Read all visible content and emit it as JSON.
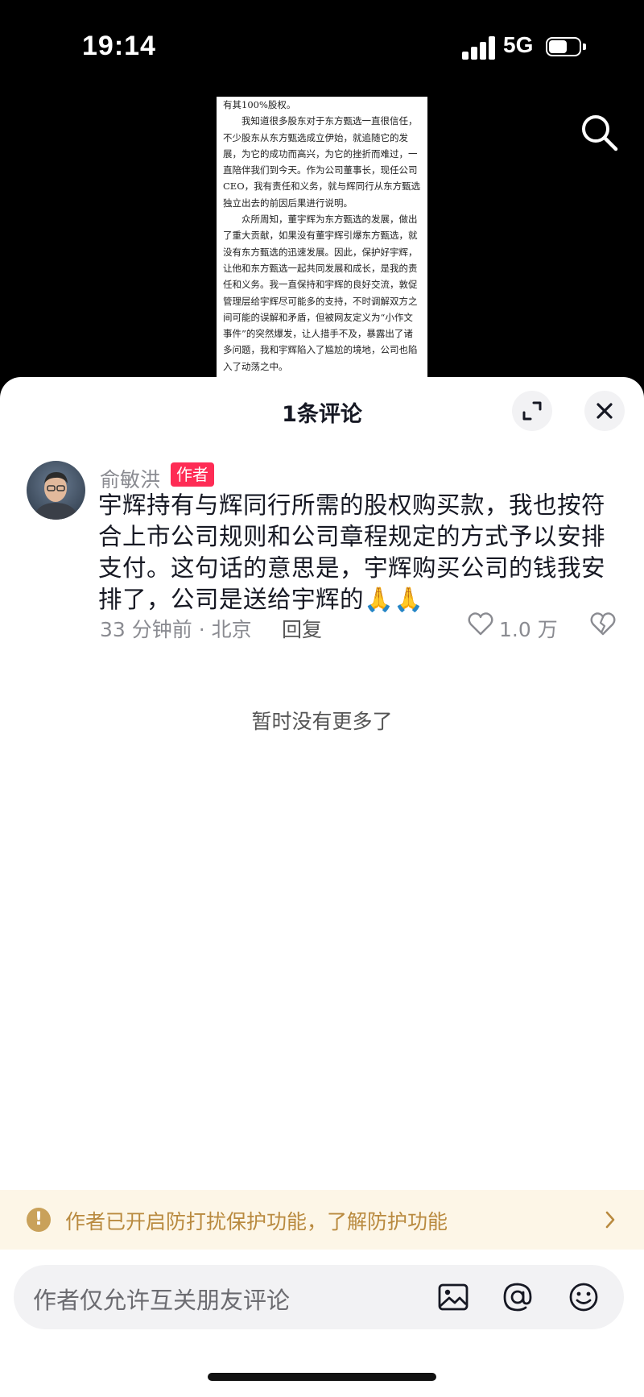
{
  "status_bar": {
    "time": "19:14",
    "network": "5G"
  },
  "document_image": {
    "paragraphs": [
      {
        "text": "有其100%股权。",
        "indent": false
      },
      {
        "text": "我知道很多股东对于东方甄选一直很信任，不少股东从东方甄选成立伊始，就追随它的发展，为它的成功而高兴，为它的挫折而难过，一直陪伴我们到今天。作为公司董事长，现任公司CEO，我有责任和义务，就与辉同行从东方甄选独立出去的前因后果进行说明。",
        "indent": true
      },
      {
        "text": "众所周知，董宇辉为东方甄选的发展，做出了重大贡献，如果没有董宇辉引爆东方甄选，就没有东方甄选的迅速发展。因此，保护好宇辉，让他和东方甄选一起共同发展和成长，是我的责任和义务。我一直保持和宇辉的良好交流，敦促管理层给宇辉尽可能多的支持，不时调解双方之间可能的误解和矛盾，但被网友定义为“小作文事件”的突然爆发，让人措手不及，暴露出了诸多问题，我和宇辉陷入了尴尬的境地，公司也陷入了动荡之中。",
        "indent": true
      }
    ]
  },
  "sheet": {
    "title": "1条评论",
    "comment": {
      "author": "俞敏洪",
      "badge": "作者",
      "text": "宇辉持有与辉同行所需的股权购买款，我也按符合上市公司规则和公司章程规定的方式予以安排支付。这句话的意思是，宇辉购买公司的钱我安排了，公司是送给宇辉的🙏🙏",
      "meta": "33 分钟前 · 北京",
      "reply_label": "回复",
      "like_count": "1.0 万"
    },
    "no_more": "暂时没有更多了",
    "notice": "作者已开启防打扰保护功能，了解防护功能",
    "input_placeholder": "作者仅允许互关朋友评论"
  },
  "colors": {
    "accent_badge": "#fe2c55",
    "notice_bg": "#fdf6e7",
    "notice_text": "#b98a3f"
  },
  "icons": [
    "search-icon",
    "expand-icon",
    "close-icon",
    "heart-icon",
    "broken-heart-icon",
    "info-icon",
    "chevron-right-icon",
    "image-icon",
    "at-icon",
    "emoji-icon"
  ]
}
